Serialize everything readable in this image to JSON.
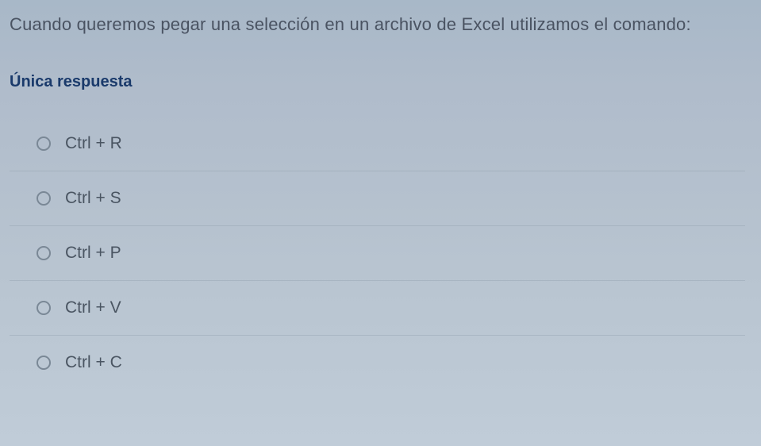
{
  "question": {
    "text": "Cuando queremos pegar una selección en un archivo de Excel utilizamos el comando:",
    "answer_type": "Única respuesta"
  },
  "options": [
    {
      "label": "Ctrl + R"
    },
    {
      "label": "Ctrl + S"
    },
    {
      "label": "Ctrl + P"
    },
    {
      "label": "Ctrl + V"
    },
    {
      "label": "Ctrl + C"
    }
  ]
}
